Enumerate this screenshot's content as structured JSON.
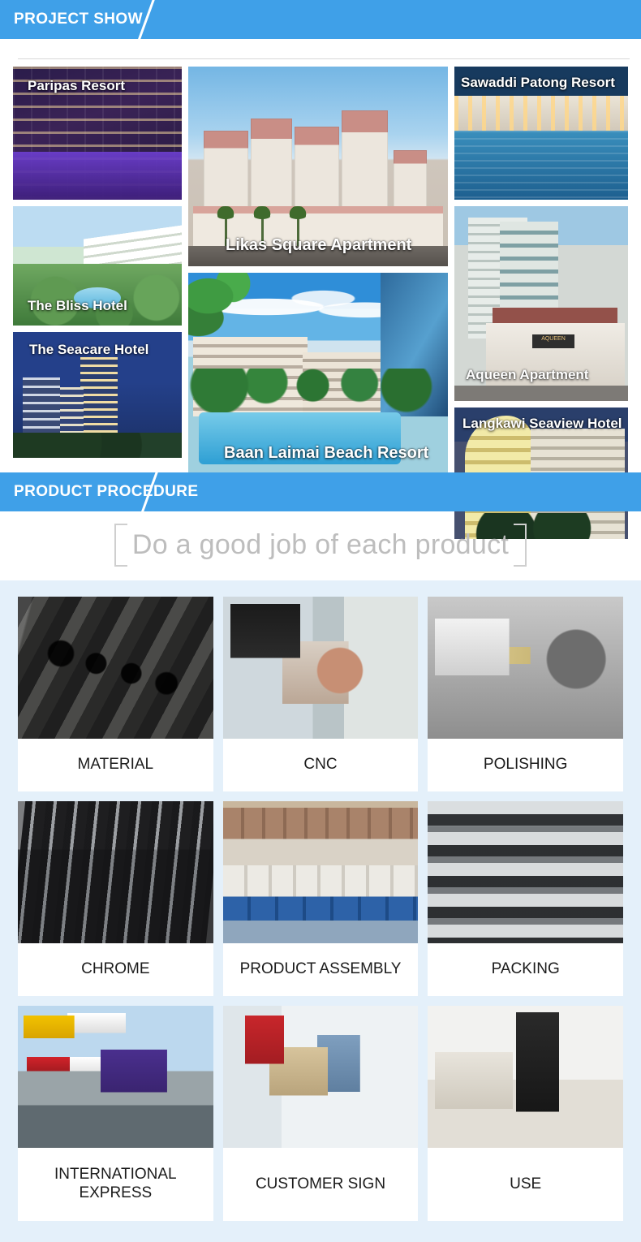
{
  "sections": {
    "project": {
      "banner_label": "PROJECT SHOW",
      "projects": [
        {
          "id": "paripas",
          "caption": "Paripas  Resort"
        },
        {
          "id": "likas",
          "caption": "Likas Square Apartment"
        },
        {
          "id": "sawaddi",
          "caption": "Sawaddi Patong Resort"
        },
        {
          "id": "bliss",
          "caption": "The Bliss Hotel"
        },
        {
          "id": "aqueen",
          "caption": "Aqueen Apartment"
        },
        {
          "id": "seacare",
          "caption": "The Seacare Hotel"
        },
        {
          "id": "baan",
          "caption": "Baan Laimai Beach Resort"
        },
        {
          "id": "langkawi",
          "caption": "Langkawi Seaview Hotel"
        }
      ]
    },
    "procedure": {
      "banner_label": "PRODUCT PROCEDURE",
      "slogan": "Do a good job of each product",
      "steps": [
        {
          "label": "MATERIAL"
        },
        {
          "label": "CNC"
        },
        {
          "label": "POLISHING"
        },
        {
          "label": "CHROME"
        },
        {
          "label": "PRODUCT ASSEMBLY"
        },
        {
          "label": "PACKING"
        },
        {
          "label": "INTERNATIONAL EXPRESS"
        },
        {
          "label": "CUSTOMER SIGN"
        },
        {
          "label": "USE"
        }
      ]
    }
  },
  "brand": {
    "aqueen_sign": "AQUEEN",
    "accent_blue": "#3fa0e8",
    "procedure_bg": "#e4f0fa",
    "slogan_gray": "#bdbdbd"
  }
}
